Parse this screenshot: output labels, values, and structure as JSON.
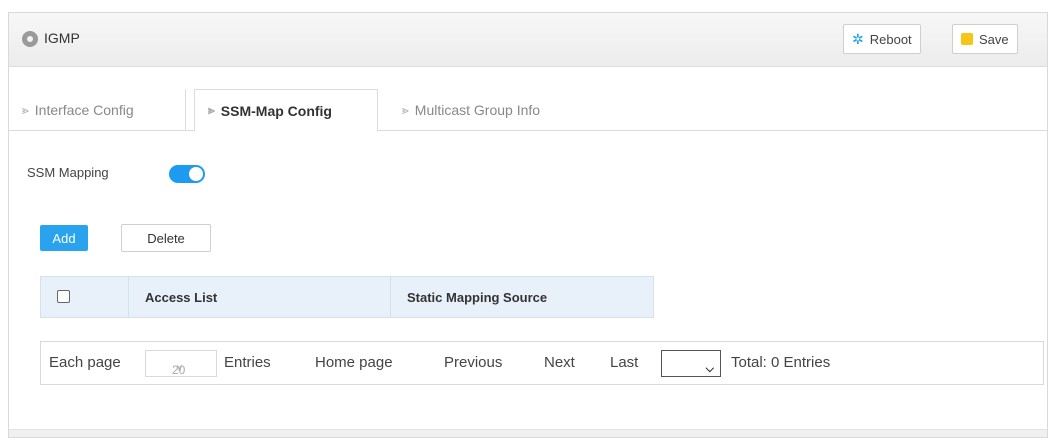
{
  "header": {
    "title": "IGMP",
    "reboot_label": "Reboot",
    "save_label": "Save"
  },
  "tabs": [
    {
      "label": "Interface Config",
      "active": false
    },
    {
      "label": "SSM-Map Config",
      "active": true
    },
    {
      "label": "Multicast Group Info",
      "active": false
    }
  ],
  "ssm": {
    "label": "SSM Mapping",
    "enabled": true
  },
  "actions": {
    "add_label": "Add",
    "delete_label": "Delete"
  },
  "table": {
    "columns": [
      "Access List",
      "Static Mapping Source"
    ],
    "rows": []
  },
  "pager": {
    "each_page": "Each page",
    "page_size": "20",
    "entries": "Entries",
    "home": "Home page",
    "previous": "Previous",
    "next": "Next",
    "last": "Last",
    "total": "Total: 0 Entries"
  },
  "colors": {
    "accent": "#2aa3ef",
    "toggle_on": "#1d9bf0",
    "table_header": "#e8f1fa"
  }
}
